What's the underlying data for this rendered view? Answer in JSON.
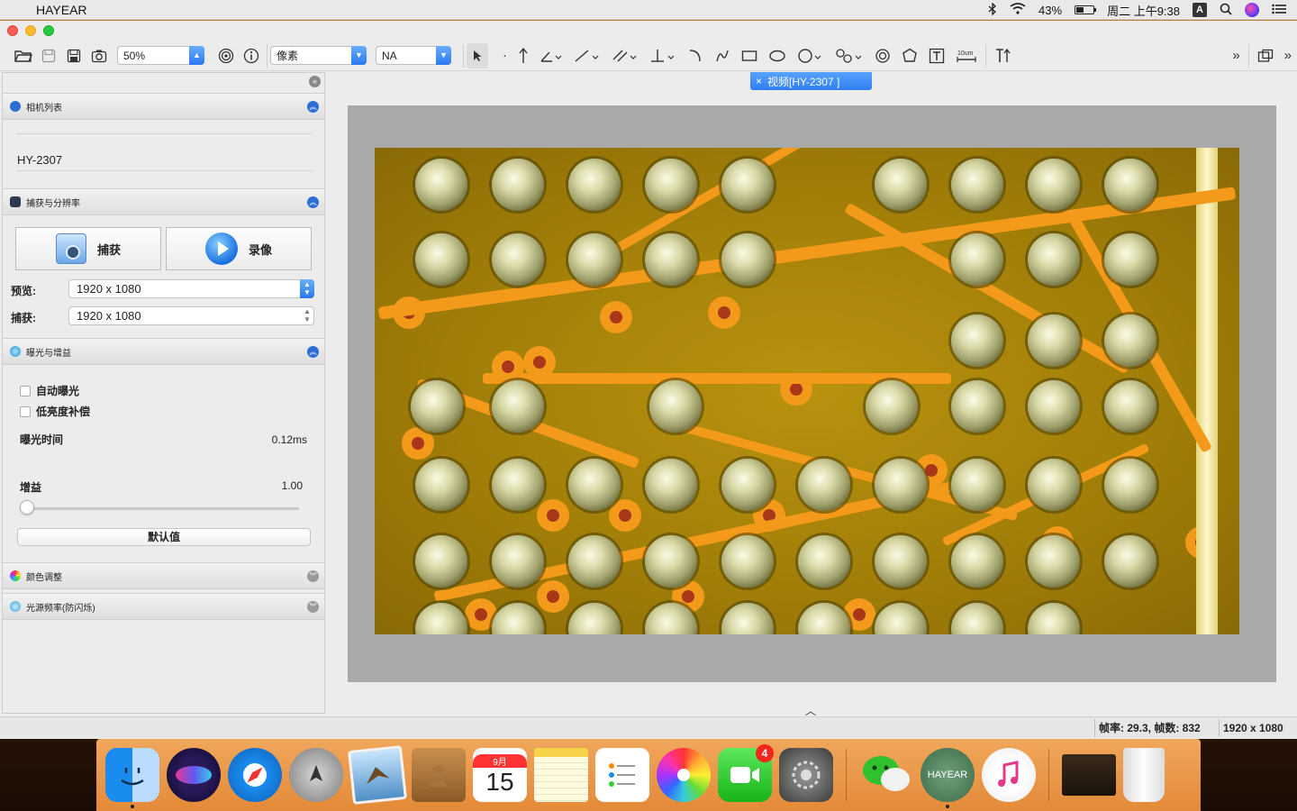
{
  "menubar": {
    "apple_glyph": "",
    "app_name": "HAYEAR",
    "battery_percent": "43%",
    "battery_level": 0.43,
    "clock": "周二 上午9:38",
    "input_source": "A"
  },
  "toolbar": {
    "zoom_value": "50%",
    "unit_value": "像素",
    "objective_value": "NA",
    "scale_label": "10um"
  },
  "left_panel": {
    "camera_section": {
      "title": "相机列表",
      "camera_name": "HY-2307"
    },
    "capture_section": {
      "title": "捕获与分辨率",
      "capture_button": "捕获",
      "record_button": "录像",
      "preview_label": "预览:",
      "preview_value": "1920 x 1080",
      "capture_label": "捕获:",
      "capture_value": "1920 x 1080"
    },
    "exposure_section": {
      "title": "曝光与增益",
      "auto_exposure_label": "自动曝光",
      "low_light_label": "低亮度补偿",
      "exposure_time_label": "曝光时间",
      "exposure_time_value": "0.12ms",
      "gain_label": "增益",
      "gain_value": "1.00",
      "default_button": "默认值"
    },
    "color_section": {
      "title": "颜色调整"
    },
    "light_section": {
      "title": "光源频率(防闪烁)"
    }
  },
  "viewer": {
    "tab_label": "视频[HY-2307 ]",
    "tab_close": "×"
  },
  "statusbar": {
    "fps_text": "帧率: 29.3, 帧数: 832",
    "resolution_text": "1920 x 1080"
  },
  "dock": {
    "calendar_month": "9月",
    "calendar_day": "15",
    "facetime_badge": "4",
    "hayear_label": "HAYEAR"
  },
  "colors": {
    "accent_blue": "#2f7ef0",
    "pcb_orange": "#f39a1a",
    "pcb_base": "#a07d08"
  }
}
